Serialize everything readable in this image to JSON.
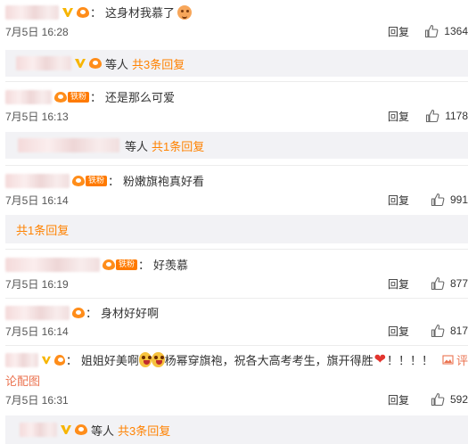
{
  "comments": [
    {
      "text": "这身材我慕了",
      "time": "7月5日 16:28",
      "reply_label": "回复",
      "likes": "1364",
      "sub": {
        "suffix": "等人",
        "count_text": "共3条回复"
      }
    },
    {
      "fan_badge": "铁粉",
      "text": "还是那么可爱",
      "time": "7月5日 16:13",
      "reply_label": "回复",
      "likes": "1178",
      "sub": {
        "suffix": "等人",
        "count_text": "共1条回复"
      }
    },
    {
      "fan_badge": "铁粉",
      "text": "粉嫩旗袍真好看",
      "time": "7月5日 16:14",
      "reply_label": "回复",
      "likes": "991",
      "sub": {
        "count_text": "共1条回复"
      }
    },
    {
      "fan_badge": "铁粉",
      "text": "好羡慕",
      "time": "7月5日 16:19",
      "reply_label": "回复",
      "likes": "877"
    },
    {
      "text": "身材好好啊",
      "time": "7月5日 16:14",
      "reply_label": "回复",
      "likes": "817"
    },
    {
      "text_part1": "姐姐好美啊",
      "text_part2": "杨幂穿旗袍，祝各大高考考生，旗开得胜",
      "text_part3": "！！！！",
      "pic_label": "评",
      "pic_label_wrap": "论配图",
      "time": "7月5日 16:31",
      "reply_label": "回复",
      "likes": "592",
      "sub": {
        "suffix": "等人",
        "count_text": "共3条回复"
      }
    }
  ],
  "colors": {
    "link_orange": "#ff8200",
    "sub_bg": "#f2f2f5",
    "fan_badge": "#ff7a00",
    "heart": "#e3352e"
  },
  "icons": {
    "like": "thumbs-up-icon",
    "verified": "v-badge-icon",
    "picture": "picture-icon"
  }
}
